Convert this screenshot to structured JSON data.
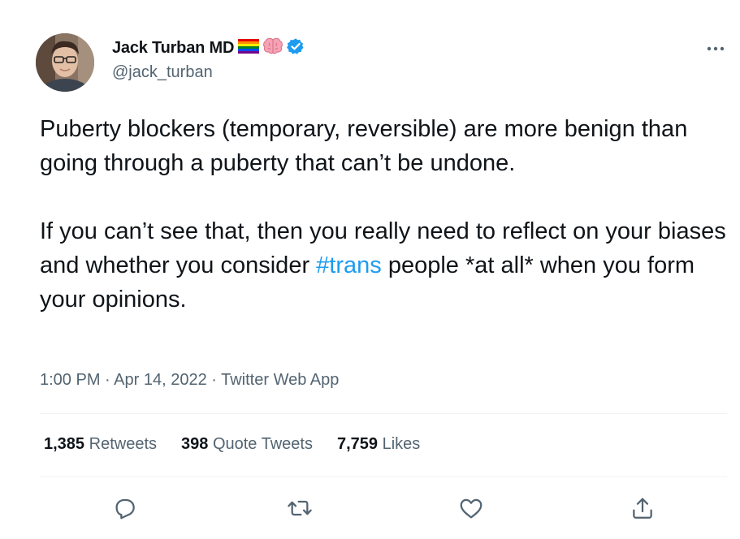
{
  "author": {
    "display_name": "Jack Turban MD",
    "handle": "@jack_turban",
    "badges": [
      "rainbow-flag-icon",
      "brain-icon",
      "verified-badge-icon"
    ]
  },
  "tweet": {
    "paragraph1": "Puberty blockers (temporary, reversible) are more benign than going through a puberty that can’t be undone.",
    "paragraph2_before": "If you can’t see that, then you really need to reflect on your biases and whether you consider ",
    "hashtag": "#trans",
    "paragraph2_after": " people *at all* when you form your opinions."
  },
  "meta": {
    "time": "1:00 PM",
    "sep1": " · ",
    "date": "Apr 14, 2022",
    "sep2": " · ",
    "source": "Twitter Web App"
  },
  "stats": {
    "retweets_count": "1,385",
    "retweets_label": "Retweets",
    "quotes_count": "398",
    "quotes_label": "Quote Tweets",
    "likes_count": "7,759",
    "likes_label": "Likes"
  },
  "actions": [
    "reply-icon",
    "retweet-icon",
    "like-icon",
    "share-icon"
  ],
  "colors": {
    "text": "#0f1419",
    "secondary": "#536471",
    "accent": "#1d9bf0",
    "divider": "#eff3f4"
  }
}
